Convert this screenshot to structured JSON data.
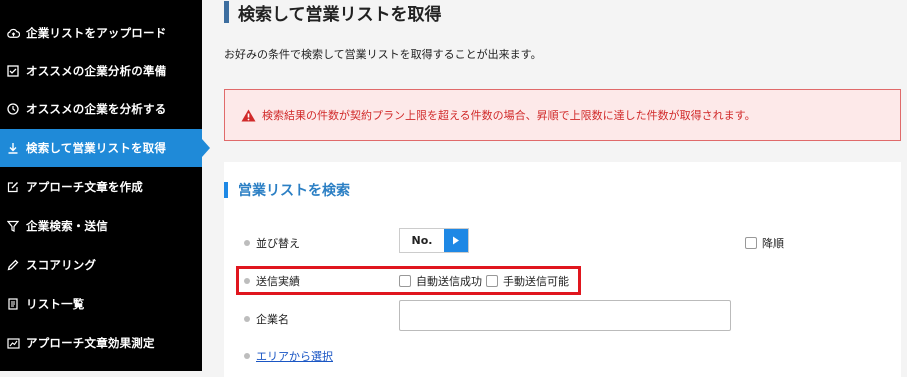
{
  "sidebar": {
    "items": [
      {
        "label": "企業リストをアップロード",
        "icon": "cloud-upload-icon"
      },
      {
        "label": "オススメの企業分析の準備",
        "icon": "checkbox-icon"
      },
      {
        "label": "オススメの企業を分析する",
        "icon": "clock-icon"
      },
      {
        "label": "検索して営業リストを取得",
        "icon": "download-icon",
        "active": true
      },
      {
        "label": "アプローチ文章を作成",
        "icon": "edit-icon"
      },
      {
        "label": "企業検索・送信",
        "icon": "filter-icon"
      },
      {
        "label": "スコアリング",
        "icon": "pencil-icon"
      },
      {
        "label": "リスト一覧",
        "icon": "document-icon"
      },
      {
        "label": "アプローチ文章効果測定",
        "icon": "chart-icon"
      }
    ]
  },
  "main": {
    "title": "検索して営業リストを取得",
    "subtitle": "お好みの条件で検索して営業リストを取得することが出来ます。",
    "alert": "検索結果の件数が契約プラン上限を超える件数の場合、昇順で上限数に達した件数が取得されます。"
  },
  "search": {
    "section_title": "営業リストを検索",
    "sort_label": "並び替え",
    "sort_value": "No.",
    "desc_label": "降順",
    "send_label": "送信実績",
    "auto_send_label": "自動送信成功",
    "manual_send_label": "手動送信可能",
    "company_label": "企業名",
    "company_value": "",
    "area_link": "エリアから選択"
  },
  "colors": {
    "sidebar_bg": "#000000",
    "active": "#1f8ad8",
    "alert_text": "#d12a2a",
    "highlight": "#e0161e"
  }
}
